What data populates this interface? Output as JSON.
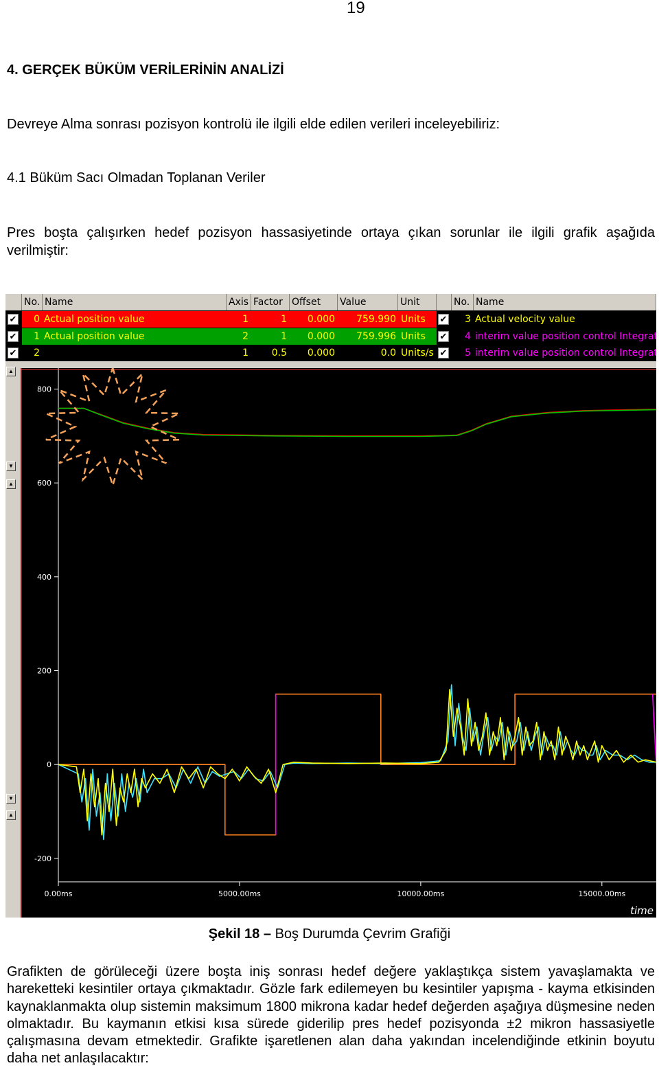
{
  "page_number": "19",
  "heading_main": "4. GERÇEK BÜKÜM VERİLERİNİN ANALİZİ",
  "intro_text": "Devreye Alma sonrası pozisyon kontrolü ile ilgili elde edilen verileri inceleyebiliriz:",
  "heading_sub": "4.1 Büküm Sacı Olmadan Toplanan Veriler",
  "para_before": "Pres boşta çalışırken hedef pozisyon hassasiyetinde ortaya çıkan sorunlar ile ilgili grafik aşağıda verilmiştir:",
  "scope": {
    "headers_left": [
      "No.",
      "Name",
      "Axis",
      "Factor",
      "Offset",
      "Value",
      "Unit"
    ],
    "headers_right": [
      "No.",
      "Name"
    ],
    "rows": [
      {
        "no": "0",
        "name": "Actual position value",
        "axis": "1",
        "factor": "1",
        "offset": "0.000",
        "value": "759.990",
        "unit": "Units",
        "bg": "#ff0000",
        "color": "#ffff00"
      },
      {
        "no": "1",
        "name": "Actual position value",
        "axis": "2",
        "factor": "1",
        "offset": "0.000",
        "value": "759.996",
        "unit": "Units",
        "bg": "#00a000",
        "color": "#ffff00"
      },
      {
        "no": "2",
        "name": "",
        "axis": "1",
        "factor": "0.5",
        "offset": "0.000",
        "value": "0.0",
        "unit": "Units/s",
        "bg": "#000000",
        "color": "#ffff00"
      }
    ],
    "rows_right": [
      {
        "no": "3",
        "name": "Actual velocity value",
        "color": "#ffff00"
      },
      {
        "no": "4",
        "name": "interim value position control Integrator",
        "color": "#ff00ff"
      },
      {
        "no": "5",
        "name": "interim value position control Integrator",
        "color": "#ff00ff"
      }
    ],
    "time_label": "time"
  },
  "chart_data": {
    "type": "line",
    "title": "",
    "xlabel": "time",
    "ylabel": "",
    "xlim": [
      0,
      16500
    ],
    "ylim": [
      -250,
      830
    ],
    "x_ticks": [
      "0.00ms",
      "5000.00ms",
      "10000.00ms",
      "15000.00ms"
    ],
    "x_tick_values": [
      0,
      5000,
      10000,
      15000
    ],
    "y_ticks": [
      "800",
      "600",
      "400",
      "200",
      "0",
      "-200"
    ],
    "y_tick_values": [
      800,
      600,
      400,
      200,
      0,
      -200
    ],
    "grid": false,
    "legend": "table-top",
    "series": [
      {
        "name": "Actual position value",
        "color": "#ff0000",
        "x": [
          0,
          700,
          1200,
          1800,
          2500,
          3200,
          4000,
          6000,
          8000,
          10000,
          11000,
          11400,
          11800,
          12500,
          13500,
          14500,
          16500
        ],
        "y": [
          759,
          759,
          745,
          728,
          716,
          707,
          703,
          701,
          700,
          700,
          702,
          712,
          726,
          742,
          750,
          754,
          757
        ]
      },
      {
        "name": "Actual position value",
        "color": "#00c000",
        "x": [
          0,
          700,
          1200,
          1800,
          2500,
          3200,
          4000,
          6000,
          8000,
          10000,
          11000,
          11400,
          11800,
          12500,
          13500,
          14500,
          16500
        ],
        "y": [
          759,
          759,
          744,
          727,
          715,
          706,
          702,
          700,
          699,
          699,
          701,
          711,
          725,
          741,
          749,
          753,
          756
        ]
      },
      {
        "name": "Actual velocity value",
        "color": "#ffff00",
        "x": [
          0,
          500,
          600,
          700,
          800,
          900,
          1000,
          1100,
          1200,
          1300,
          1400,
          1500,
          1600,
          1700,
          1800,
          1900,
          2000,
          2100,
          2200,
          2300,
          2400,
          2600,
          2800,
          3000,
          3200,
          3400,
          3600,
          3800,
          4000,
          4200,
          4400,
          4600,
          4800,
          5000,
          5200,
          5400,
          5600,
          5800,
          6000,
          6200,
          6500,
          7000,
          8000,
          9000,
          10000,
          10500,
          10700,
          10800,
          10900,
          11000,
          11100,
          11200,
          11300,
          11400,
          11500,
          11600,
          11700,
          11800,
          11900,
          12000,
          12100,
          12200,
          12300,
          12400,
          12500,
          12600,
          12700,
          12800,
          12900,
          13000,
          13100,
          13200,
          13300,
          13400,
          13500,
          13600,
          13700,
          13800,
          13900,
          14000,
          14100,
          14200,
          14300,
          14400,
          14500,
          14600,
          14700,
          14800,
          14900,
          15000,
          15200,
          15400,
          15600,
          15800,
          16000,
          16200,
          16500
        ],
        "y": [
          0,
          -5,
          -60,
          -10,
          -120,
          -20,
          -90,
          -30,
          -150,
          -40,
          -100,
          -10,
          -130,
          -50,
          -80,
          -20,
          -60,
          -10,
          -90,
          -30,
          -50,
          -20,
          -40,
          -10,
          -60,
          -5,
          -30,
          -10,
          -50,
          -5,
          -20,
          -30,
          -10,
          -35,
          -5,
          -25,
          -40,
          -10,
          -60,
          0,
          5,
          3,
          2,
          3,
          2,
          5,
          30,
          160,
          60,
          120,
          80,
          20,
          140,
          40,
          90,
          30,
          60,
          110,
          20,
          70,
          40,
          100,
          10,
          80,
          30,
          60,
          100,
          20,
          80,
          40,
          50,
          90,
          10,
          70,
          30,
          50,
          10,
          80,
          20,
          60,
          40,
          10,
          50,
          20,
          40,
          10,
          30,
          50,
          5,
          40,
          10,
          30,
          5,
          20,
          5,
          10,
          5
        ]
      },
      {
        "name": "Actual velocity value",
        "color": "#40e0ff",
        "x": [
          0,
          550,
          650,
          750,
          850,
          950,
          1050,
          1150,
          1250,
          1350,
          1450,
          1550,
          1650,
          1750,
          1850,
          1950,
          2050,
          2150,
          2250,
          2350,
          2450,
          2650,
          2850,
          3050,
          3250,
          3450,
          3650,
          3850,
          4050,
          4250,
          4450,
          4650,
          4850,
          5050,
          5250,
          5450,
          5650,
          5850,
          6050,
          6250,
          6500,
          7000,
          8000,
          9000,
          10000,
          10550,
          10750,
          10850,
          10950,
          11050,
          11150,
          11250,
          11350,
          11450,
          11550,
          11650,
          11750,
          11850,
          11950,
          12050,
          12150,
          12250,
          12350,
          12450,
          12550,
          12650,
          12750,
          12850,
          12950,
          13050,
          13150,
          13250,
          13350,
          13450,
          13550,
          13650,
          13750,
          13850,
          13950,
          14050,
          14150,
          14250,
          14350,
          14450,
          14550,
          14650,
          14750,
          14850,
          14950,
          15100,
          15300,
          15500,
          15700,
          15900,
          16100,
          16300,
          16500
        ],
        "y": [
          0,
          -20,
          -80,
          -30,
          -140,
          -10,
          -110,
          -60,
          -160,
          -20,
          -120,
          -40,
          -110,
          -20,
          -100,
          -40,
          -70,
          -30,
          -80,
          -10,
          -60,
          -30,
          -30,
          -20,
          -50,
          -10,
          -40,
          -5,
          -40,
          -15,
          -25,
          -20,
          -15,
          -30,
          -10,
          -30,
          -35,
          -15,
          -50,
          0,
          3,
          2,
          3,
          2,
          4,
          8,
          50,
          170,
          40,
          130,
          60,
          30,
          120,
          50,
          80,
          20,
          70,
          100,
          30,
          60,
          50,
          90,
          20,
          70,
          40,
          50,
          90,
          30,
          70,
          30,
          60,
          80,
          20,
          60,
          40,
          40,
          20,
          70,
          30,
          50,
          30,
          20,
          40,
          30,
          30,
          20,
          20,
          40,
          10,
          30,
          20,
          20,
          10,
          20,
          10,
          5,
          5
        ]
      },
      {
        "name": "interim value position control Integrator",
        "color": "#ff8020",
        "x": [
          0,
          4600,
          4600,
          6000,
          6000,
          8900,
          8900,
          12600,
          12600,
          16500
        ],
        "y": [
          0,
          0,
          -150,
          -150,
          150,
          150,
          0,
          0,
          150,
          150
        ]
      },
      {
        "name": "interim value position control Integrator",
        "color": "#ff00ff",
        "x": [
          0,
          5999,
          6000,
          6000,
          6001,
          16400,
          16400,
          16500
        ],
        "y": [
          null,
          null,
          -150,
          150,
          null,
          null,
          150,
          0
        ]
      }
    ]
  },
  "caption_label": "Şekil 18",
  "caption_dash": "–",
  "caption_text": "Boş Durumda Çevrim Grafiği",
  "para_after": "Grafikten de görüleceği üzere boşta iniş sonrası hedef değere yaklaştıkça sistem yavaşlamakta ve hareketteki kesintiler ortaya çıkmaktadır. Gözle fark edilemeyen bu kesintiler yapışma - kayma etkisinden kaynaklanmakta olup sistemin maksimum 1800 mikrona kadar hedef değerden aşağıya düşmesine neden olmaktadır. Bu kaymanın etkisi kısa sürede giderilip pres hedef pozisyonda ±2 mikron hassasiyetle çalışmasına devam etmektedir. Grafikte işaretlenen alan daha yakından incelendiğinde etkinin boyutu daha net anlaşılacaktır:"
}
